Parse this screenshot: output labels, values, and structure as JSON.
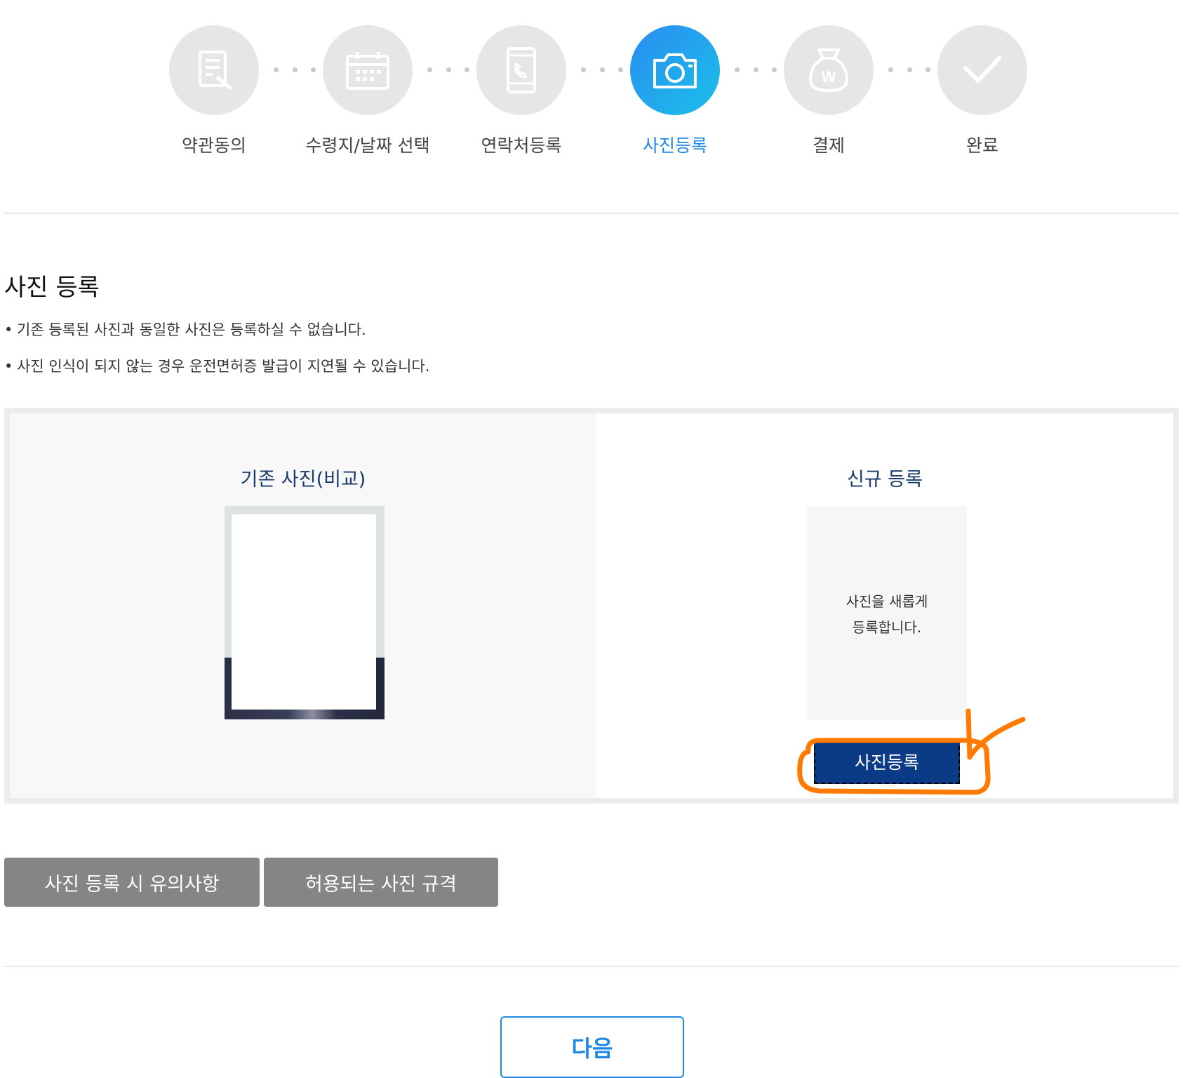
{
  "stepper": {
    "steps": [
      {
        "label": "약관동의",
        "icon": "document-edit-icon"
      },
      {
        "label": "수령지/날짜 선택",
        "icon": "calendar-icon"
      },
      {
        "label": "연락처등록",
        "icon": "phone-icon"
      },
      {
        "label": "사진등록",
        "icon": "camera-icon",
        "active": true
      },
      {
        "label": "결제",
        "icon": "money-bag-icon"
      },
      {
        "label": "완료",
        "icon": "check-icon"
      }
    ]
  },
  "section": {
    "title": "사진 등록",
    "notices": [
      "기존 등록된 사진과 동일한 사진은 등록하실 수 없습니다.",
      "사진 인식이 되지 않는 경우 운전면허증 발급이 지연될 수 있습니다."
    ]
  },
  "photo_panel": {
    "existing_title": "기존 사진(비교)",
    "new_title": "신규 등록",
    "new_placeholder_line1": "사진을 새롭게",
    "new_placeholder_line2": "등록합니다.",
    "register_button": "사진등록"
  },
  "buttons": {
    "precautions": "사진 등록 시 유의사항",
    "allowed_spec": "허용되는 사진 규격",
    "next": "다음"
  },
  "colors": {
    "active_blue": "#1e88e5",
    "navy": "#0b3a87",
    "annotation_orange": "#ff7a00",
    "inactive_gray": "#e6e6e6"
  }
}
